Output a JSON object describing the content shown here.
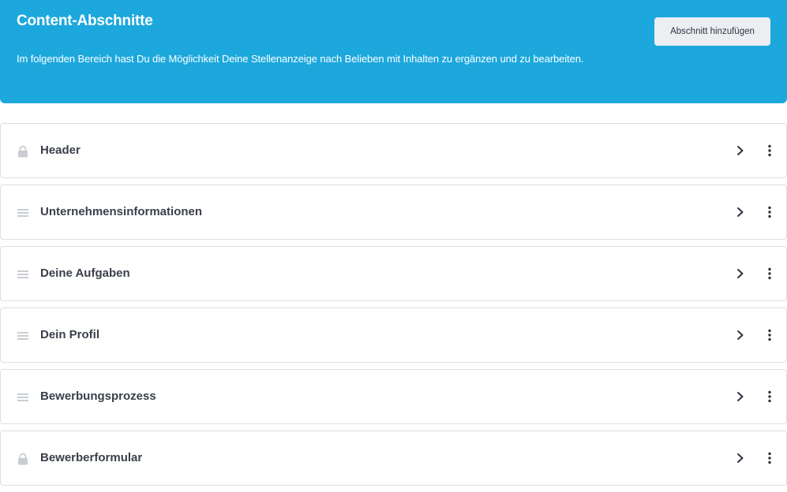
{
  "header": {
    "title": "Content-Abschnitte",
    "description": "Im folgenden Bereich hast Du die Möglichkeit Deine Stellenanzeige nach Belieben mit Inhalten zu ergänzen und zu bearbeiten.",
    "add_button_label": "Abschnitt hinzufügen"
  },
  "sections": [
    {
      "label": "Header",
      "icon": "lock-icon",
      "locked": true
    },
    {
      "label": "Unternehmensinformationen",
      "icon": "drag-handle-icon",
      "locked": false
    },
    {
      "label": "Deine Aufgaben",
      "icon": "drag-handle-icon",
      "locked": false
    },
    {
      "label": "Dein Profil",
      "icon": "drag-handle-icon",
      "locked": false
    },
    {
      "label": "Bewerbungsprozess",
      "icon": "drag-handle-icon",
      "locked": false
    },
    {
      "label": "Bewerberformular",
      "icon": "lock-icon",
      "locked": true
    }
  ],
  "colors": {
    "banner": "#1ca8dd",
    "button_bg": "#eceef2",
    "text": "#3a3f4a",
    "icon_muted": "#c9cdd3",
    "border": "#dcdfe4"
  }
}
